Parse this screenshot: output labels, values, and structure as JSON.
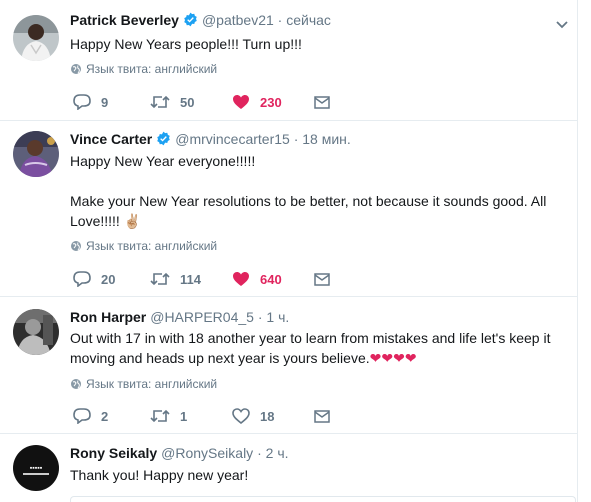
{
  "lang_label": "Язык твита: английский",
  "tweets": [
    {
      "name": "Patrick Beverley",
      "handle": "@patbev21",
      "time": "сейчас",
      "text": "Happy New Years people!!! Turn up!!!",
      "replies": "9",
      "retweets": "50",
      "likes": "230"
    },
    {
      "name": "Vince Carter",
      "handle": "@mrvincecarter15",
      "time": "18 мин.",
      "text1": "Happy New Year everyone!!!!!",
      "text2": "Make your New Year resolutions to be better, not because it sounds good. All",
      "text3": "Love!!!!!",
      "emoji": "✌🏼",
      "replies": "20",
      "retweets": "114",
      "likes": "640"
    },
    {
      "name": "Ron Harper",
      "handle": "@HARPER04_5",
      "time": "1 ч.",
      "text1": "Out with 17 in with 18 another year to learn from mistakes and life let's keep it",
      "text2": "moving and heads up next year is yours believe.",
      "hearts": "❤❤❤❤",
      "replies": "2",
      "retweets": "1",
      "likes": "18"
    },
    {
      "name": "Rony Seikaly",
      "handle": "@RonySeikaly",
      "time": "2 ч.",
      "text": "Thank you! Happy new year!"
    }
  ],
  "icons": {
    "verified": "verified-badge-icon",
    "reply": "reply-icon",
    "retweet": "retweet-icon",
    "like": "heart-icon",
    "message": "envelope-icon",
    "globe": "globe-icon",
    "caret": "chevron-down-icon"
  },
  "colors": {
    "accent": "#1da1f2",
    "like": "#e0245e",
    "muted": "#657786",
    "border": "#e6ecf0"
  }
}
